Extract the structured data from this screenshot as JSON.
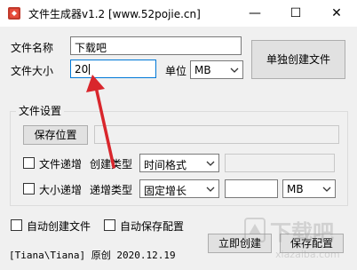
{
  "window": {
    "title": "文件生成器v1.2 [www.52pojie.cn]",
    "app_icon": "app-icon",
    "controls": {
      "minimize": "—",
      "maximize": "☐",
      "close": "✕"
    }
  },
  "form": {
    "file_name_label": "文件名称",
    "file_name_value": "下载吧",
    "file_size_label": "文件大小",
    "file_size_value": "20",
    "unit_label": "单位",
    "unit_value": "MB",
    "single_create_button": "单独创建文件"
  },
  "settings": {
    "group_title": "文件设置",
    "save_location_button": "保存位置",
    "save_location_value": "",
    "file_increment_label": "文件递增",
    "file_increment_checked": false,
    "create_type_label": "创建类型",
    "create_type_value": "时间格式",
    "create_type_extra_value": "",
    "size_increment_label": "大小递增",
    "size_increment_checked": false,
    "increment_type_label": "递增类型",
    "increment_type_value": "固定增长",
    "increment_amount_value": "",
    "increment_unit_value": "MB"
  },
  "options": {
    "auto_create_label": "自动创建文件",
    "auto_create_checked": false,
    "auto_save_config_label": "自动保存配置",
    "auto_save_config_checked": false
  },
  "footer": {
    "credit": "[Tiana\\Tiana] 原创 2020.12.19",
    "create_now_button": "立即创建",
    "save_config_button": "保存配置"
  },
  "accent_colors": {
    "focus_border": "#0078d7",
    "annotation_arrow": "#d9262c"
  },
  "overlay": {
    "arrow_icon": "red-arrow-icon",
    "watermark_text": "下载吧"
  }
}
